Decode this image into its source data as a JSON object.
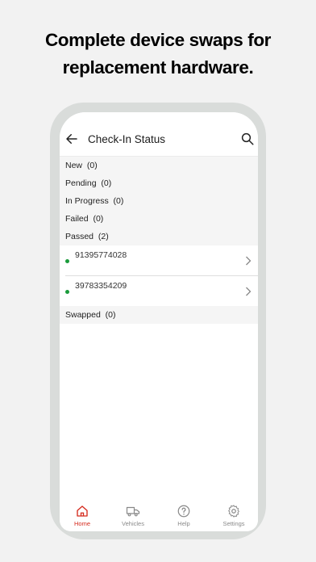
{
  "headline": {
    "line1": "Complete device swaps for",
    "line2": "replacement hardware."
  },
  "appbar": {
    "title": "Check-In Status",
    "back_icon": "arrow-left-icon",
    "search_icon": "search-icon"
  },
  "status_groups": [
    {
      "label": "New",
      "count": "(0)"
    },
    {
      "label": "Pending",
      "count": "(0)"
    },
    {
      "label": "In Progress",
      "count": "(0)"
    },
    {
      "label": "Failed",
      "count": "(0)"
    },
    {
      "label": "Passed",
      "count": "(2)"
    },
    {
      "label": "Swapped",
      "count": "(0)"
    }
  ],
  "passed_devices": [
    {
      "id": "91395774028",
      "status_color": "#1a9b3b"
    },
    {
      "id": "39783354209",
      "status_color": "#1a9b3b"
    }
  ],
  "bottom_nav": [
    {
      "label": "Home",
      "icon": "home-icon",
      "active": true
    },
    {
      "label": "Vehicles",
      "icon": "truck-icon",
      "active": false
    },
    {
      "label": "Help",
      "icon": "help-icon",
      "active": false
    },
    {
      "label": "Settings",
      "icon": "gear-icon",
      "active": false
    }
  ],
  "colors": {
    "accent": "#d52b1e",
    "status_ok": "#1a9b3b",
    "background": "#f2f2f2",
    "phone_frame": "#d9dcda"
  }
}
